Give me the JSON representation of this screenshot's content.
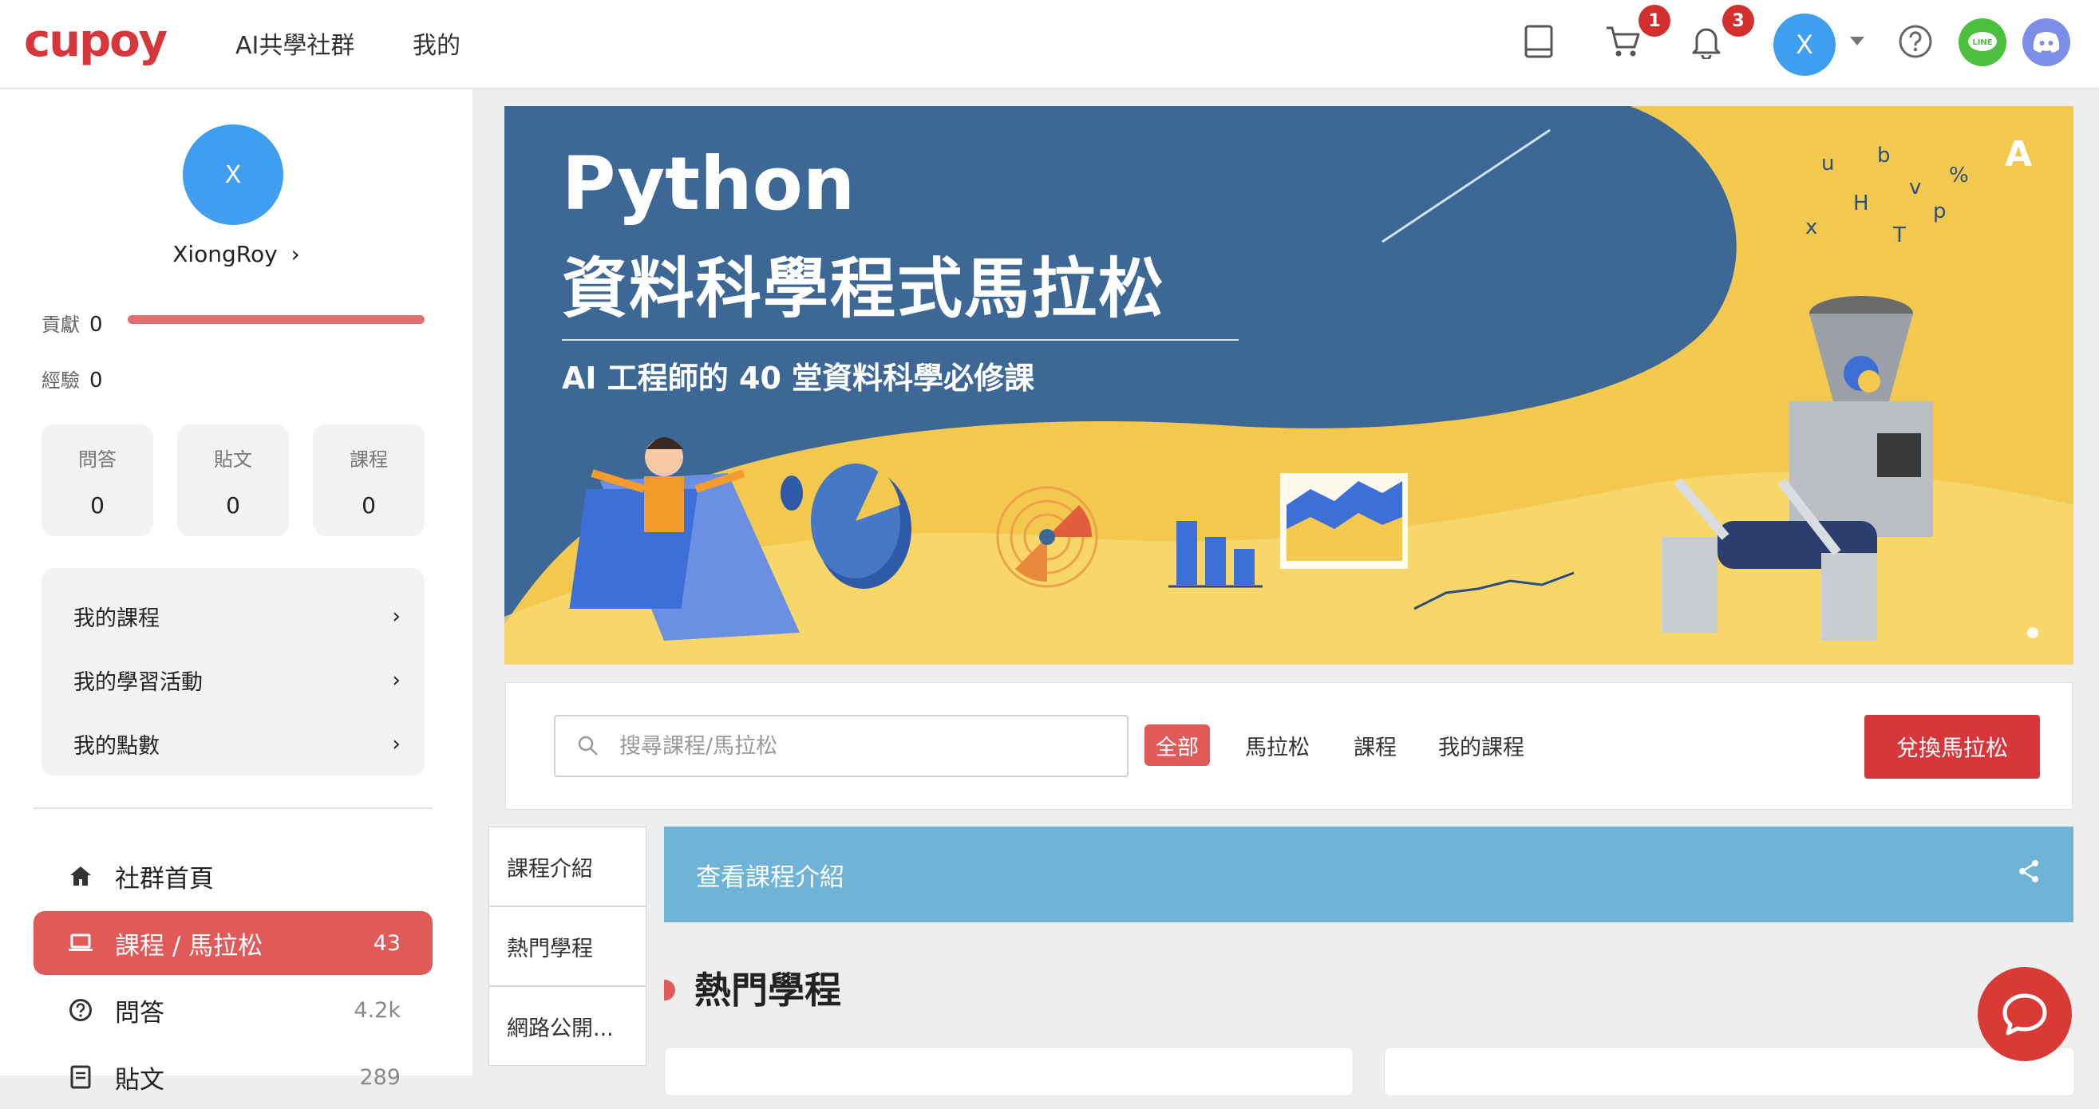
{
  "brand": {
    "logo_text": "cupoy",
    "accent": "#d5373a"
  },
  "topnav": {
    "community": "AI共學社群",
    "mine": "我的"
  },
  "topbar": {
    "cart_badge": "1",
    "notif_badge": "3",
    "avatar_initial": "X",
    "icons": [
      "book-icon",
      "cart-icon",
      "bell-icon",
      "chevron-down-icon",
      "help-icon",
      "line-icon",
      "discord-icon"
    ]
  },
  "profile": {
    "avatar_initial": "X",
    "username": "XiongRoy",
    "contribution_label": "貢獻",
    "contribution_value": "0",
    "contribution_progress": 1.0,
    "experience_label": "經驗",
    "experience_value": "0",
    "counts": [
      {
        "label": "問答",
        "value": "0"
      },
      {
        "label": "貼文",
        "value": "0"
      },
      {
        "label": "課程",
        "value": "0"
      }
    ]
  },
  "quick_menu": [
    "我的課程",
    "我的學習活動",
    "我的點數"
  ],
  "side_nav": [
    {
      "label": "社群首頁",
      "count": ""
    },
    {
      "label": "課程 / 馬拉松",
      "count": "43",
      "active": true
    },
    {
      "label": "問答",
      "count": "4.2k"
    },
    {
      "label": "貼文",
      "count": "289"
    }
  ],
  "banner": {
    "title": "Python",
    "subtitle": "資料科學程式馬拉松",
    "tagline": "AI 工程師的 40 堂資料科學必修課"
  },
  "search": {
    "placeholder": "搜尋課程/馬拉松",
    "filters": [
      "全部",
      "馬拉松",
      "課程",
      "我的課程"
    ],
    "exchange_label": "兌換馬拉松"
  },
  "side_tabs": [
    "課程介紹",
    "熱門學程",
    "網路公開..."
  ],
  "intro_bar": {
    "label": "查看課程介紹"
  },
  "section": {
    "title": "熱門學程"
  }
}
